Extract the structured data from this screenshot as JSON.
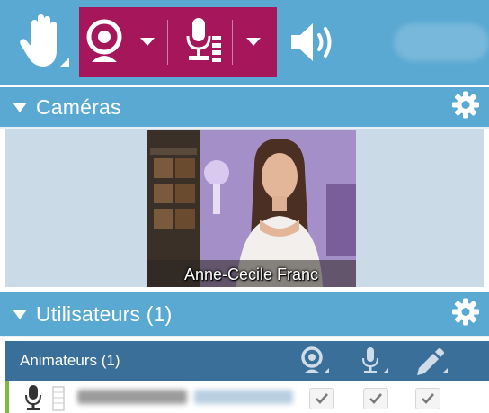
{
  "toolbar": {
    "buttons": [
      {
        "icon": "raise-hand-icon"
      },
      {
        "icon": "webcam-icon",
        "active": true
      },
      {
        "icon": "microphone-icon",
        "active": true
      },
      {
        "icon": "speaker-icon"
      }
    ],
    "active_color": "#a5175a",
    "bar_color": "#5aa9d3"
  },
  "cameras_section": {
    "title": "Caméras",
    "settings_icon": "gear-icon",
    "video": {
      "participant_name": "Anne-Cecile Franc"
    }
  },
  "users_section": {
    "title": "Utilisateurs (1)",
    "settings_icon": "gear-icon",
    "group": {
      "title": "Animateurs (1)",
      "columns": [
        {
          "icon": "webcam-icon"
        },
        {
          "icon": "microphone-icon"
        },
        {
          "icon": "pencil-icon"
        }
      ]
    },
    "rows": [
      {
        "status_icon": "microphone-icon",
        "checks": [
          true,
          true,
          true
        ]
      }
    ]
  },
  "colors": {
    "header": "#5aa9d3",
    "sub_header": "#3a6f9a",
    "camera_bg": "#cadbe7",
    "row_accent": "#7dbb3d"
  }
}
